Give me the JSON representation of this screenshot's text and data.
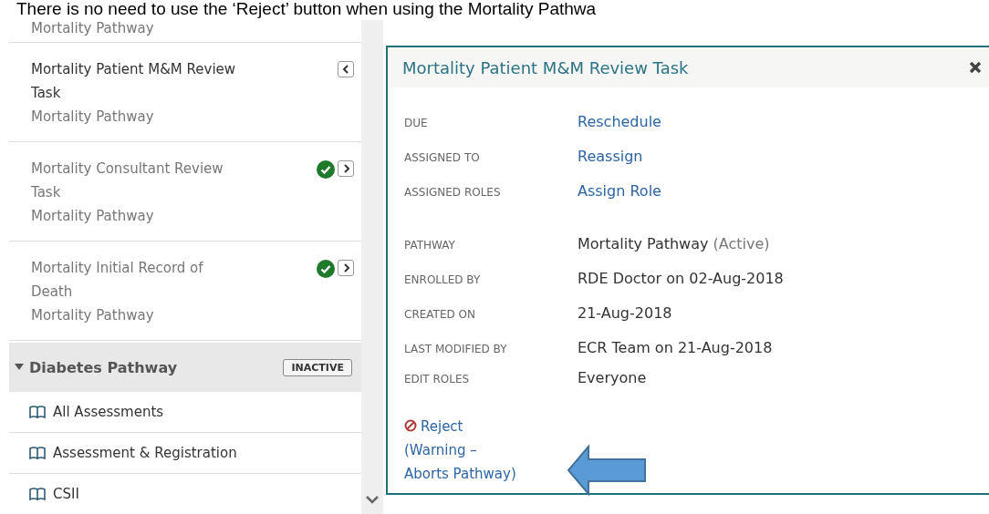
{
  "caption": "There is no need to use the ‘Reject’ button when using the Mortality Pathwa",
  "sidebar": {
    "top_subtitle": "Mortality Pathway",
    "tasks": [
      {
        "title": "Mortality Patient M&M Review Task",
        "pathway": "Mortality Pathway",
        "selected": true,
        "completed": false
      },
      {
        "title": "Mortality Consultant Review Task",
        "pathway": "Mortality Pathway",
        "selected": false,
        "completed": true
      },
      {
        "title": "Mortality Initial Record of Death",
        "pathway": "Mortality Pathway",
        "selected": false,
        "completed": true
      }
    ],
    "group": {
      "title": "Diabetes Pathway",
      "badge": "INACTIVE",
      "expanded": true,
      "items": [
        "All Assessments",
        "Assessment & Registration",
        "CSII"
      ]
    }
  },
  "panel": {
    "title": "Mortality Patient M&M Review Task",
    "sections": [
      [
        {
          "label": "DUE",
          "kind": "link",
          "value": "Reschedule"
        },
        {
          "label": "ASSIGNED TO",
          "kind": "link",
          "value": "Reassign"
        },
        {
          "label": "ASSIGNED ROLES",
          "kind": "link",
          "value": "Assign Role"
        }
      ],
      [
        {
          "label": "PATHWAY",
          "kind": "text",
          "value": "Mortality Pathway",
          "status": "(Active)"
        },
        {
          "label": "ENROLLED BY",
          "kind": "text",
          "value": "RDE Doctor on 02-Aug-2018"
        },
        {
          "label": "CREATED ON",
          "kind": "text",
          "value": "21-Aug-2018"
        },
        {
          "label": "LAST MODIFIED BY",
          "kind": "text",
          "value": "ECR Team on 21-Aug-2018"
        },
        {
          "label": "EDIT ROLES",
          "kind": "text",
          "value": "Everyone"
        }
      ]
    ],
    "reject_lines": [
      "Reject",
      "(Warning –",
      "Aborts Pathway)"
    ]
  }
}
